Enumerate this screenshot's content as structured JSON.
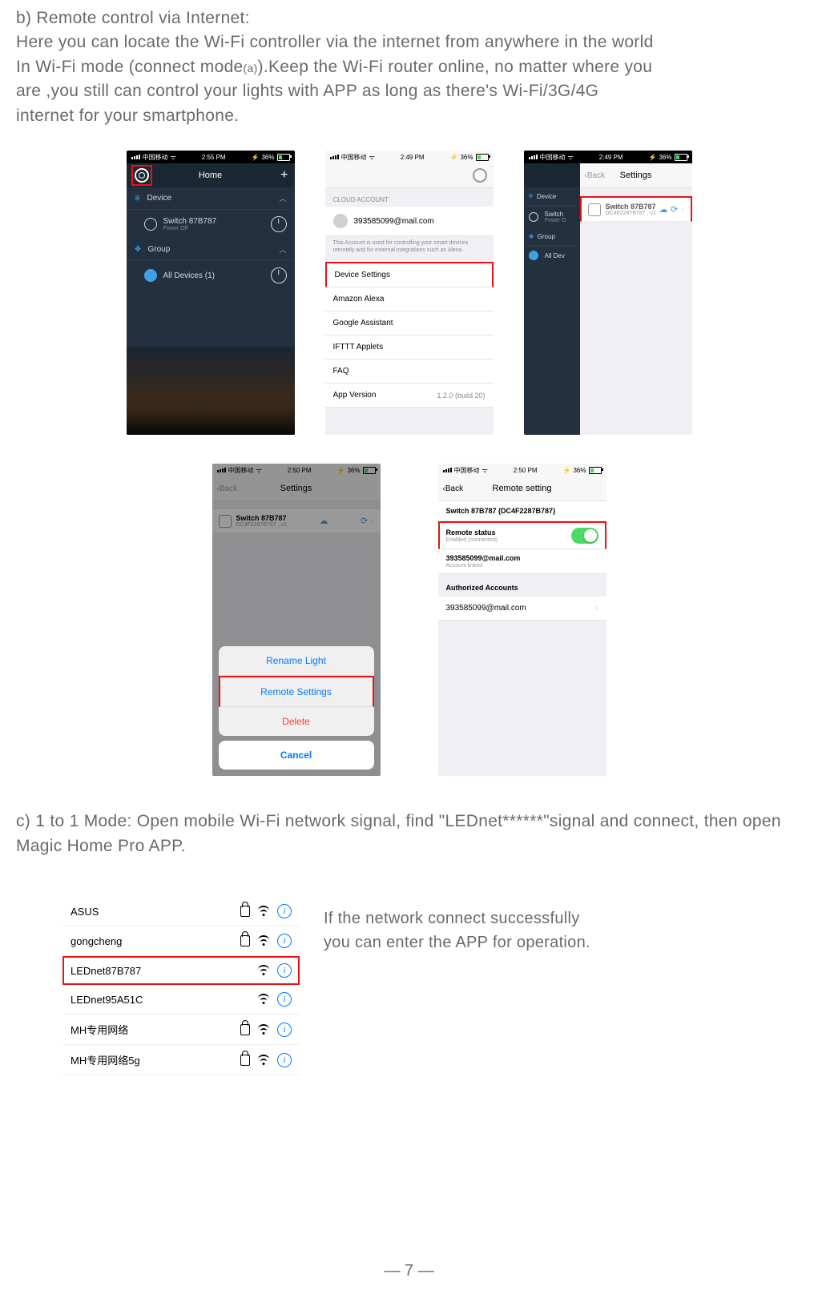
{
  "section_b": {
    "heading": "b)   Remote control via Internet:",
    "body_line1": "Here you can locate the Wi-Fi controller via the internet from anywhere in the world",
    "body_line2a": "In Wi-Fi mode (connect mode",
    "body_line2_sub": "(a)",
    "body_line2b": ").Keep the Wi-Fi router online, no matter where you",
    "body_line3": "are ,you still can control your lights with APP as long as there's Wi-Fi/3G/4G",
    "body_line4": "internet for your smartphone."
  },
  "status": {
    "carrier": "中国移动",
    "battery": "36%",
    "times": {
      "s1": "2:55 PM",
      "s2": "2:49 PM",
      "s3": "2:49 PM",
      "s4": "2:50 PM",
      "s5": "2:50 PM"
    }
  },
  "screen1": {
    "title": "Home",
    "device_label": "Device",
    "switch_name": "Switch 87B787",
    "switch_sub": "Power Off",
    "group_label": "Group",
    "all_devices": "All Devices (1)"
  },
  "screen2": {
    "cloud_label": "CLOUD ACCOUNT",
    "email": "393585099@mail.com",
    "note": "This Account is used for controlling your smart devices remotely and for external integrations such as Alexa.",
    "items": {
      "device_settings": "Device Settings",
      "alexa": "Amazon Alexa",
      "google": "Google Assistant",
      "ifttt": "IFTTT Applets",
      "faq": "FAQ",
      "version_label": "App Version",
      "version_value": "1.2.0 (build 20)"
    }
  },
  "screen3": {
    "back": "Back",
    "title": "Settings",
    "device_label": "Device",
    "switch_name": "Switch",
    "switch_sub": "Power O",
    "group_label": "Group",
    "all_devices": "All Dev",
    "item_name": "Switch 87B787",
    "item_sub": "DC4F2287B787 , v1"
  },
  "screen4": {
    "back": "Back",
    "title": "Settings",
    "item_name": "Switch 87B787",
    "item_sub": "DC4F2287B787 , v1",
    "sheet": {
      "rename": "Rename Light",
      "remote": "Remote Settings",
      "delete": "Delete",
      "cancel": "Cancel"
    }
  },
  "screen5": {
    "back": "Back",
    "title": "Remote setting",
    "device_title": "Switch 87B787 (DC4F2287B787)",
    "remote_status": "Remote status",
    "remote_sub": "Enabled (connected)",
    "account": "393585099@mail.com",
    "account_sub": "Account linked",
    "auth_label": "Authorized Accounts",
    "auth_account": "393585099@mail.com"
  },
  "section_c": {
    "text": "c)   1 to 1 Mode: Open mobile Wi-Fi network signal, find \"LEDnet******\"signal and connect, then open Magic Home Pro APP.",
    "note_line1": "If the network connect successfully",
    "note_line2": "you can enter the APP for operation."
  },
  "wifi": {
    "n1": "ASUS",
    "n2": "gongcheng",
    "n3": "LEDnet87B787",
    "n4": "LEDnet95A51C",
    "n5": "MH专用网络",
    "n6": "MH专用网络5g"
  },
  "page_number": "— 7 —"
}
